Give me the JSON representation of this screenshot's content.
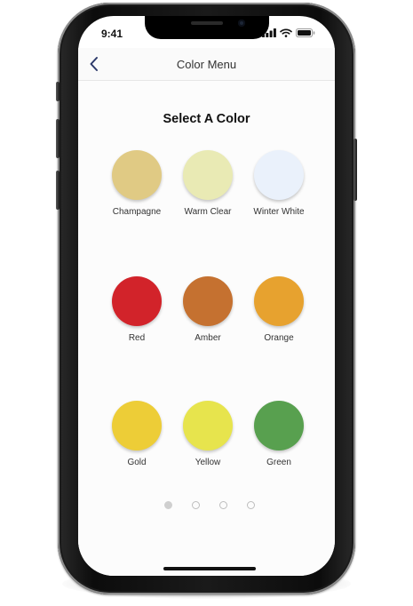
{
  "status_bar": {
    "time": "9:41"
  },
  "nav": {
    "title": "Color Menu",
    "back_icon": "chevron-left-icon"
  },
  "heading": "Select A Color",
  "colors": [
    {
      "name": "Champagne",
      "hex": "#E0CA84"
    },
    {
      "name": "Warm Clear",
      "hex": "#E9EAB4"
    },
    {
      "name": "Winter White",
      "hex": "#EAF1FB"
    },
    {
      "name": "Red",
      "hex": "#D2232A"
    },
    {
      "name": "Amber",
      "hex": "#C57130"
    },
    {
      "name": "Orange",
      "hex": "#E7A22F"
    },
    {
      "name": "Gold",
      "hex": "#EDCD37"
    },
    {
      "name": "Yellow",
      "hex": "#E7E44D"
    },
    {
      "name": "Green",
      "hex": "#58A04F"
    }
  ],
  "pagination": {
    "page_count": 4,
    "current_page": 1
  }
}
